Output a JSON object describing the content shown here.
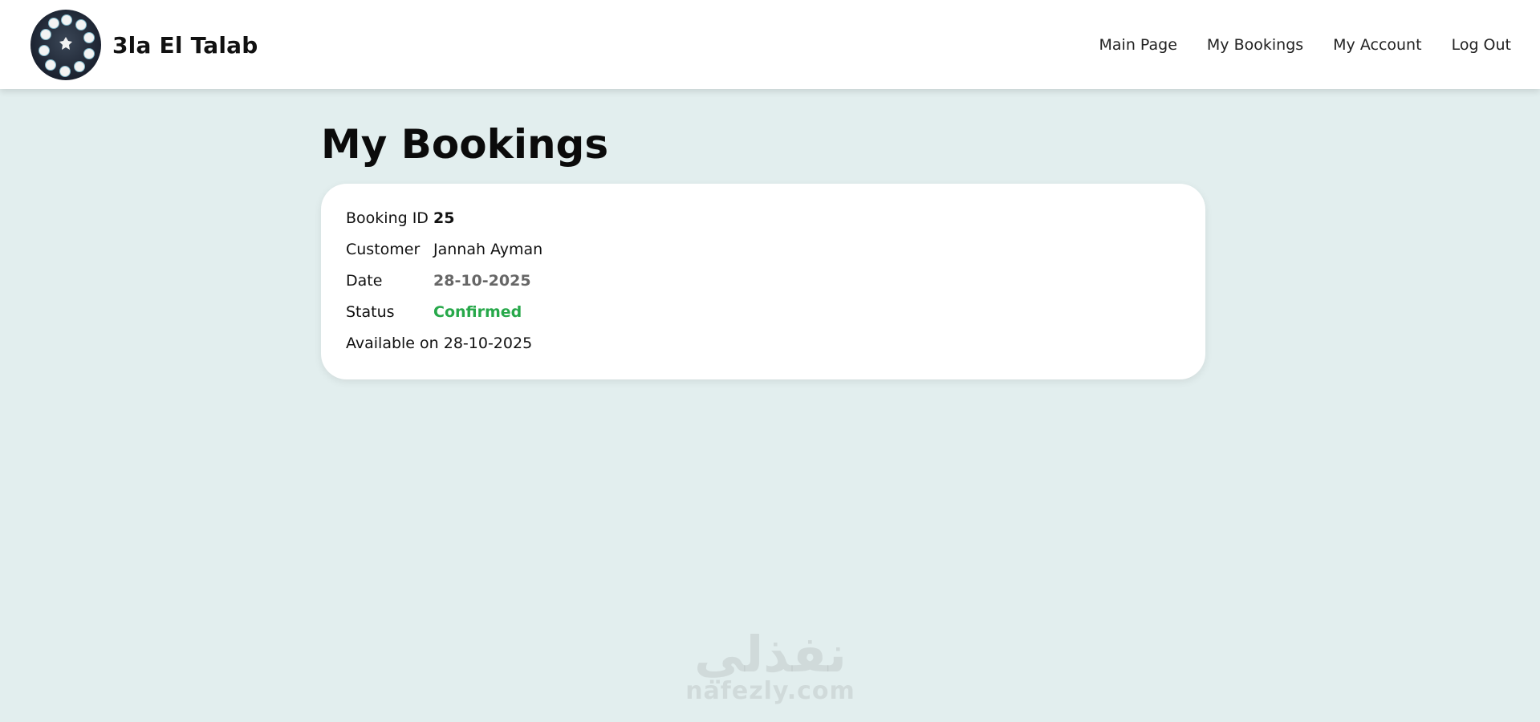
{
  "header": {
    "brand_name": "3la El Talab",
    "logo_icon": "3la-el-talab-logo",
    "nav": [
      {
        "label": "Main Page"
      },
      {
        "label": "My Bookings"
      },
      {
        "label": "My Account"
      },
      {
        "label": "Log Out"
      }
    ]
  },
  "main": {
    "title": "My Bookings",
    "booking": {
      "id_label": "Booking ID",
      "id_value": "25",
      "customer_label": "Customer",
      "customer_value": "Jannah Ayman",
      "date_label": "Date",
      "date_value": "28-10-2025",
      "status_label": "Status",
      "status_value": "Confirmed",
      "available_text": "Available on 28-10-2025"
    }
  },
  "watermark": {
    "arabic": "نفذلي",
    "latin": "nafezly.com"
  },
  "colors": {
    "background": "#e2eeee",
    "status_confirmed": "#27a84a",
    "date_text": "#666666"
  }
}
